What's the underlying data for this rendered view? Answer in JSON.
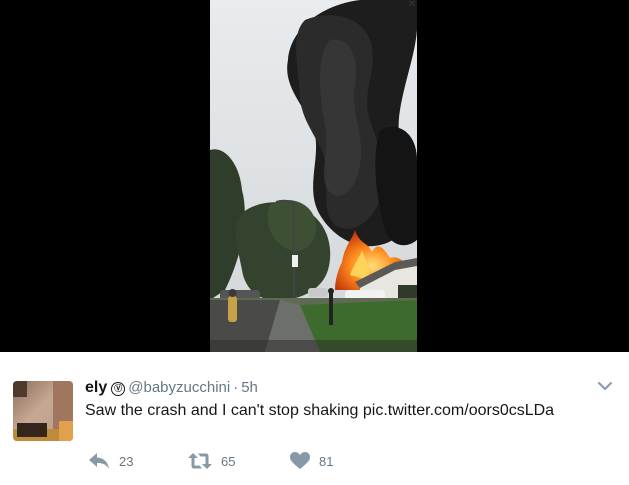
{
  "tweet": {
    "display_name": "ely",
    "handle": "@babyzucchini",
    "separator": "·",
    "timestamp": "5h",
    "text": "Saw the crash and I can't stop shaking pic.twitter.com/oors0csLDa",
    "verified_glyph": "Ⓥ"
  },
  "actions": {
    "reply_count": "23",
    "retweet_count": "65",
    "like_count": "81"
  },
  "icons": {
    "reply": "reply-icon",
    "retweet": "retweet-icon",
    "like": "heart-icon",
    "more": "chevron-down-icon",
    "close": "close-icon"
  },
  "colors": {
    "text": "#14171a",
    "muted": "#657786",
    "media_background": "#000000"
  }
}
